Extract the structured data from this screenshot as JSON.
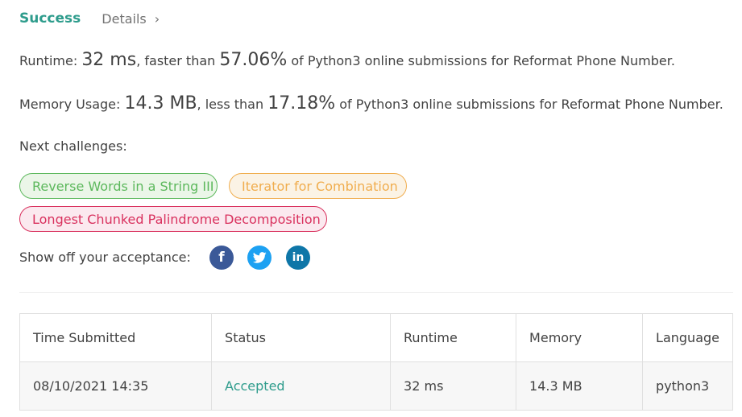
{
  "tabs": {
    "success": "Success",
    "details": "Details",
    "details_chevron": "›"
  },
  "runtime": {
    "label": "Runtime: ",
    "value": "32 ms",
    "mid": ", faster than ",
    "percent": "57.06%",
    "tail": " of Python3 online submissions for Reformat Phone Number."
  },
  "memory": {
    "label": "Memory Usage: ",
    "value": "14.3 MB",
    "mid": ", less than ",
    "percent": "17.18%",
    "tail": " of Python3 online submissions for Reformat Phone Number."
  },
  "next": {
    "label": "Next challenges:",
    "challenges": [
      {
        "title": "Reverse Words in a String III",
        "difficulty": "easy",
        "color": "#5cb85c"
      },
      {
        "title": "Iterator for Combination",
        "difficulty": "medium",
        "color": "#f0ad4e"
      },
      {
        "title": "Longest Chunked Palindrome Decomposition",
        "difficulty": "hard",
        "color": "#d9315e"
      }
    ]
  },
  "share": {
    "label": "Show off your acceptance:",
    "icons": [
      "facebook-icon",
      "twitter-icon",
      "linkedin-icon"
    ],
    "facebook_glyph": "f",
    "linkedin_glyph": "in"
  },
  "table": {
    "headers": [
      "Time Submitted",
      "Status",
      "Runtime",
      "Memory",
      "Language"
    ],
    "rows": [
      [
        "08/10/2021 14:35",
        "Accepted",
        "32 ms",
        "14.3 MB",
        "python3"
      ]
    ]
  },
  "colors": {
    "accent": "#2e9c8c",
    "easy": "#5cb85c",
    "medium": "#f0ad4e",
    "hard": "#d9315e"
  }
}
